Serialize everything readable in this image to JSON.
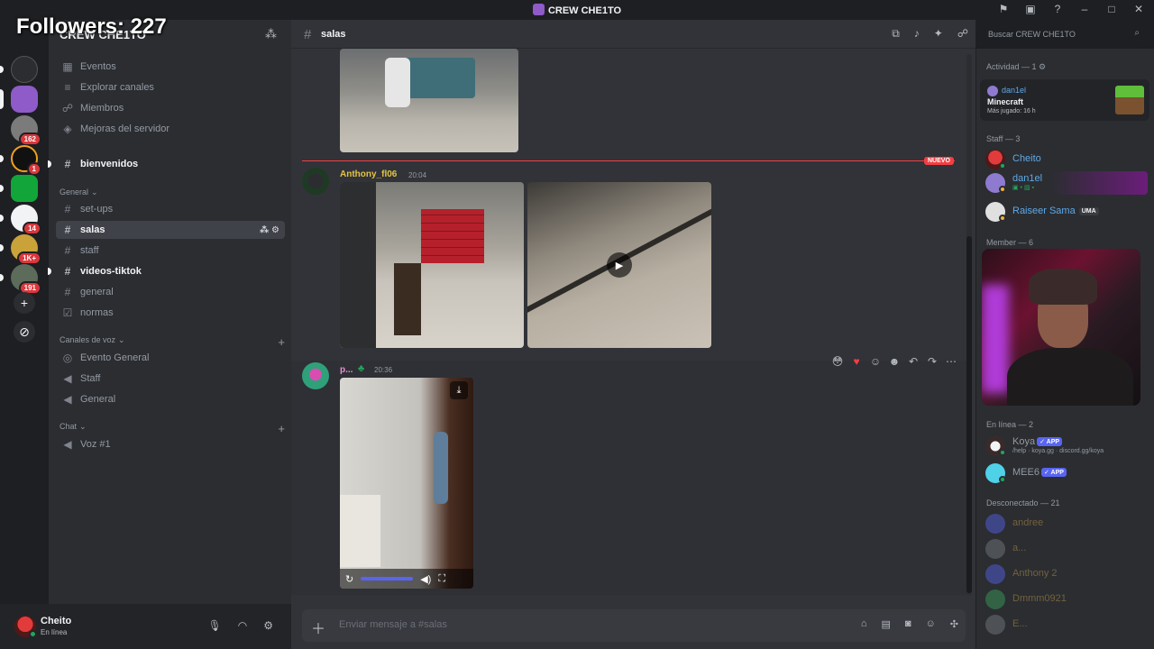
{
  "overlay": {
    "followers": "Followers: 227"
  },
  "window": {
    "title": "CREW CHE1TO"
  },
  "rail": {
    "badges": [
      "162",
      "1",
      "14",
      "1K+",
      "191"
    ]
  },
  "sidebar": {
    "server_name": "CREW CHE1TO",
    "top_items": [
      {
        "icon": "calendar-icon",
        "label": "Eventos"
      },
      {
        "icon": "browse-icon",
        "label": "Explorar canales"
      },
      {
        "icon": "members-icon",
        "label": "Miembros"
      },
      {
        "icon": "boost-icon",
        "label": "Mejoras del servidor"
      }
    ],
    "pinned_channel": "bienvenidos",
    "categories": {
      "general": "General",
      "voice": "Canales de voz",
      "chat": "Chat"
    },
    "text_channels": [
      "set-ups",
      "salas",
      "staff",
      "videos-tiktok",
      "general",
      "normas"
    ],
    "voice_channels": [
      "Evento General",
      "Staff",
      "General"
    ],
    "chat_channels": [
      "Voz #1"
    ]
  },
  "user": {
    "name": "Cheito",
    "status": "En línea"
  },
  "channel": {
    "name": "salas"
  },
  "search": {
    "placeholder": "Buscar CREW CHE1TO"
  },
  "messages": {
    "new_label": "NUEVO",
    "m1": {
      "author": "Anthony_fl06",
      "time": "20:04"
    },
    "m2": {
      "author": "p...",
      "time": "20:36"
    }
  },
  "composer": {
    "placeholder": "Enviar mensaje a #salas"
  },
  "members": {
    "activity_header": "Actividad — 1",
    "activity": {
      "user": "dan1el",
      "game": "Minecraft",
      "played": "Más jugado: 16 h"
    },
    "staff_header": "Staff — 3",
    "staff": [
      {
        "name": "Cheito",
        "color": "#5fa8e6"
      },
      {
        "name": "dan1el",
        "color": "#5fa8e6"
      },
      {
        "name": "Raiseer Sama",
        "color": "#5fa8e6",
        "tag": "UMA"
      }
    ],
    "member_header": "Member — 6",
    "online_header": "En línea — 2",
    "online": [
      {
        "name": "Koya",
        "app": "APP",
        "sub": "/help · koya.gg · discord.gg/koya"
      },
      {
        "name": "MEE6",
        "app": "APP"
      }
    ],
    "offline_header": "Desconectado — 21",
    "offline": [
      "andree",
      "a...",
      "Anthony 2",
      "Dmmm0921",
      "E..."
    ]
  }
}
